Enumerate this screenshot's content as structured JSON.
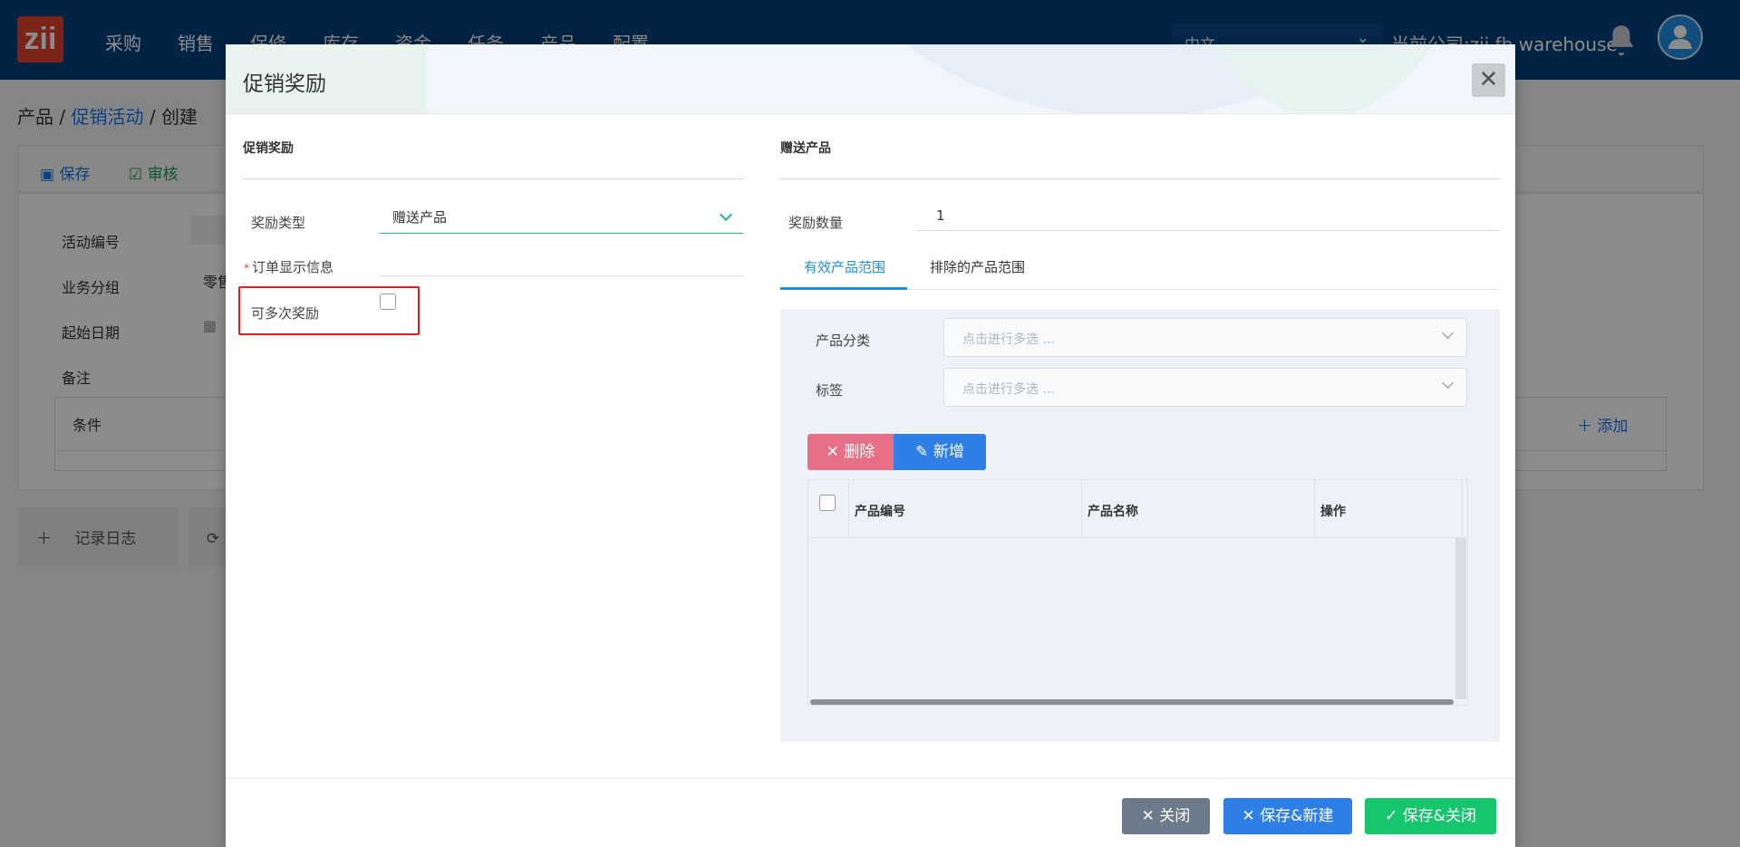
{
  "app": {
    "logo_text": "zii",
    "nav": [
      "采购",
      "销售",
      "保修",
      "库存",
      "资金",
      "任务",
      "产品",
      "配置"
    ],
    "language": "中文",
    "company": "当前公司:zii fb warehouse"
  },
  "breadcrumb": {
    "root": "产品",
    "sep1": "/",
    "parent": "促销活动",
    "sep2": "/",
    "current": "创建"
  },
  "page_toolbar": {
    "save": "保存",
    "audit": "审核"
  },
  "page_form": {
    "labels": [
      "活动编号",
      "业务分组",
      "起始日期",
      "备注"
    ],
    "group_value": "零售",
    "condition_header": "条件",
    "add_label": "添加"
  },
  "page_bottom": {
    "log": "记录日志",
    "refresh": "刷新"
  },
  "modal": {
    "title": "促销奖励",
    "left": {
      "section": "促销奖励",
      "reward_type_label": "奖励类型",
      "reward_type_value": "赠送产品",
      "order_info_label": "订单显示信息",
      "required_mark": "*",
      "multi_reward_label": "可多次奖励"
    },
    "right": {
      "section": "赠送产品",
      "quantity_label": "奖励数量",
      "quantity_value": "1",
      "tabs": [
        "有效产品范围",
        "排除的产品范围"
      ],
      "category_label": "产品分类",
      "tag_label": "标签",
      "multiselect_placeholder": "点击进行多选 ...",
      "delete_label": "删除",
      "new_label": "新增",
      "columns": [
        "产品编号",
        "产品名称",
        "操作"
      ]
    },
    "footer": {
      "close": "关闭",
      "save_new": "保存&新建",
      "save_close": "保存&关闭"
    }
  },
  "colors": {
    "header": "#04407c",
    "primary": "#2f7fe6",
    "success": "#17c56f",
    "danger": "#e76f86",
    "muted": "#6c7a89",
    "highlight": "#e02020"
  }
}
